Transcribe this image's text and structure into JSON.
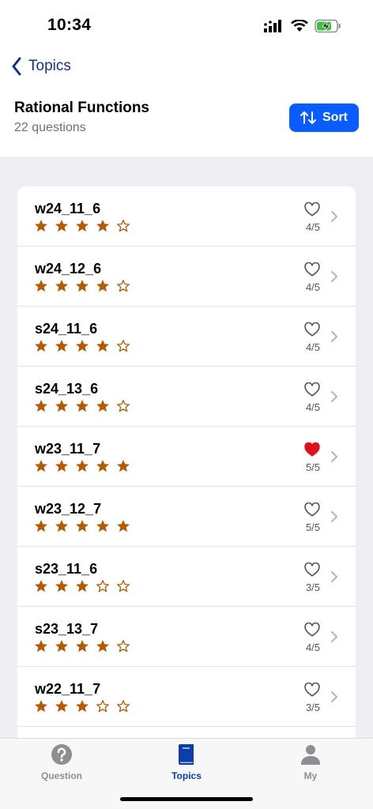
{
  "status_bar": {
    "time": "10:34"
  },
  "nav": {
    "back_label": "Topics",
    "back_icon": "chevron-left-icon"
  },
  "header": {
    "title": "Rational Functions",
    "subtitle": "22 questions"
  },
  "sort_button": {
    "label": "Sort",
    "icon": "sort-arrows-icon"
  },
  "colors": {
    "accent": "#0b5cff",
    "star": "#b65a00",
    "heart_active": "#e0101e",
    "nav_blue": "#14328c"
  },
  "questions": [
    {
      "title": "w24_11_6",
      "rating": 4,
      "favorite": false,
      "score": "4/5"
    },
    {
      "title": "w24_12_6",
      "rating": 4,
      "favorite": false,
      "score": "4/5"
    },
    {
      "title": "s24_11_6",
      "rating": 4,
      "favorite": false,
      "score": "4/5"
    },
    {
      "title": "s24_13_6",
      "rating": 4,
      "favorite": false,
      "score": "4/5"
    },
    {
      "title": "w23_11_7",
      "rating": 5,
      "favorite": true,
      "score": "5/5"
    },
    {
      "title": "w23_12_7",
      "rating": 5,
      "favorite": false,
      "score": "5/5"
    },
    {
      "title": "s23_11_6",
      "rating": 3,
      "favorite": false,
      "score": "3/5"
    },
    {
      "title": "s23_13_7",
      "rating": 4,
      "favorite": false,
      "score": "4/5"
    },
    {
      "title": "w22_11_7",
      "rating": 3,
      "favorite": false,
      "score": "3/5"
    }
  ],
  "tabs": [
    {
      "label": "Question",
      "icon": "question-circle-icon",
      "active": false
    },
    {
      "label": "Topics",
      "icon": "book-icon",
      "active": true
    },
    {
      "label": "My",
      "icon": "person-icon",
      "active": false
    }
  ]
}
